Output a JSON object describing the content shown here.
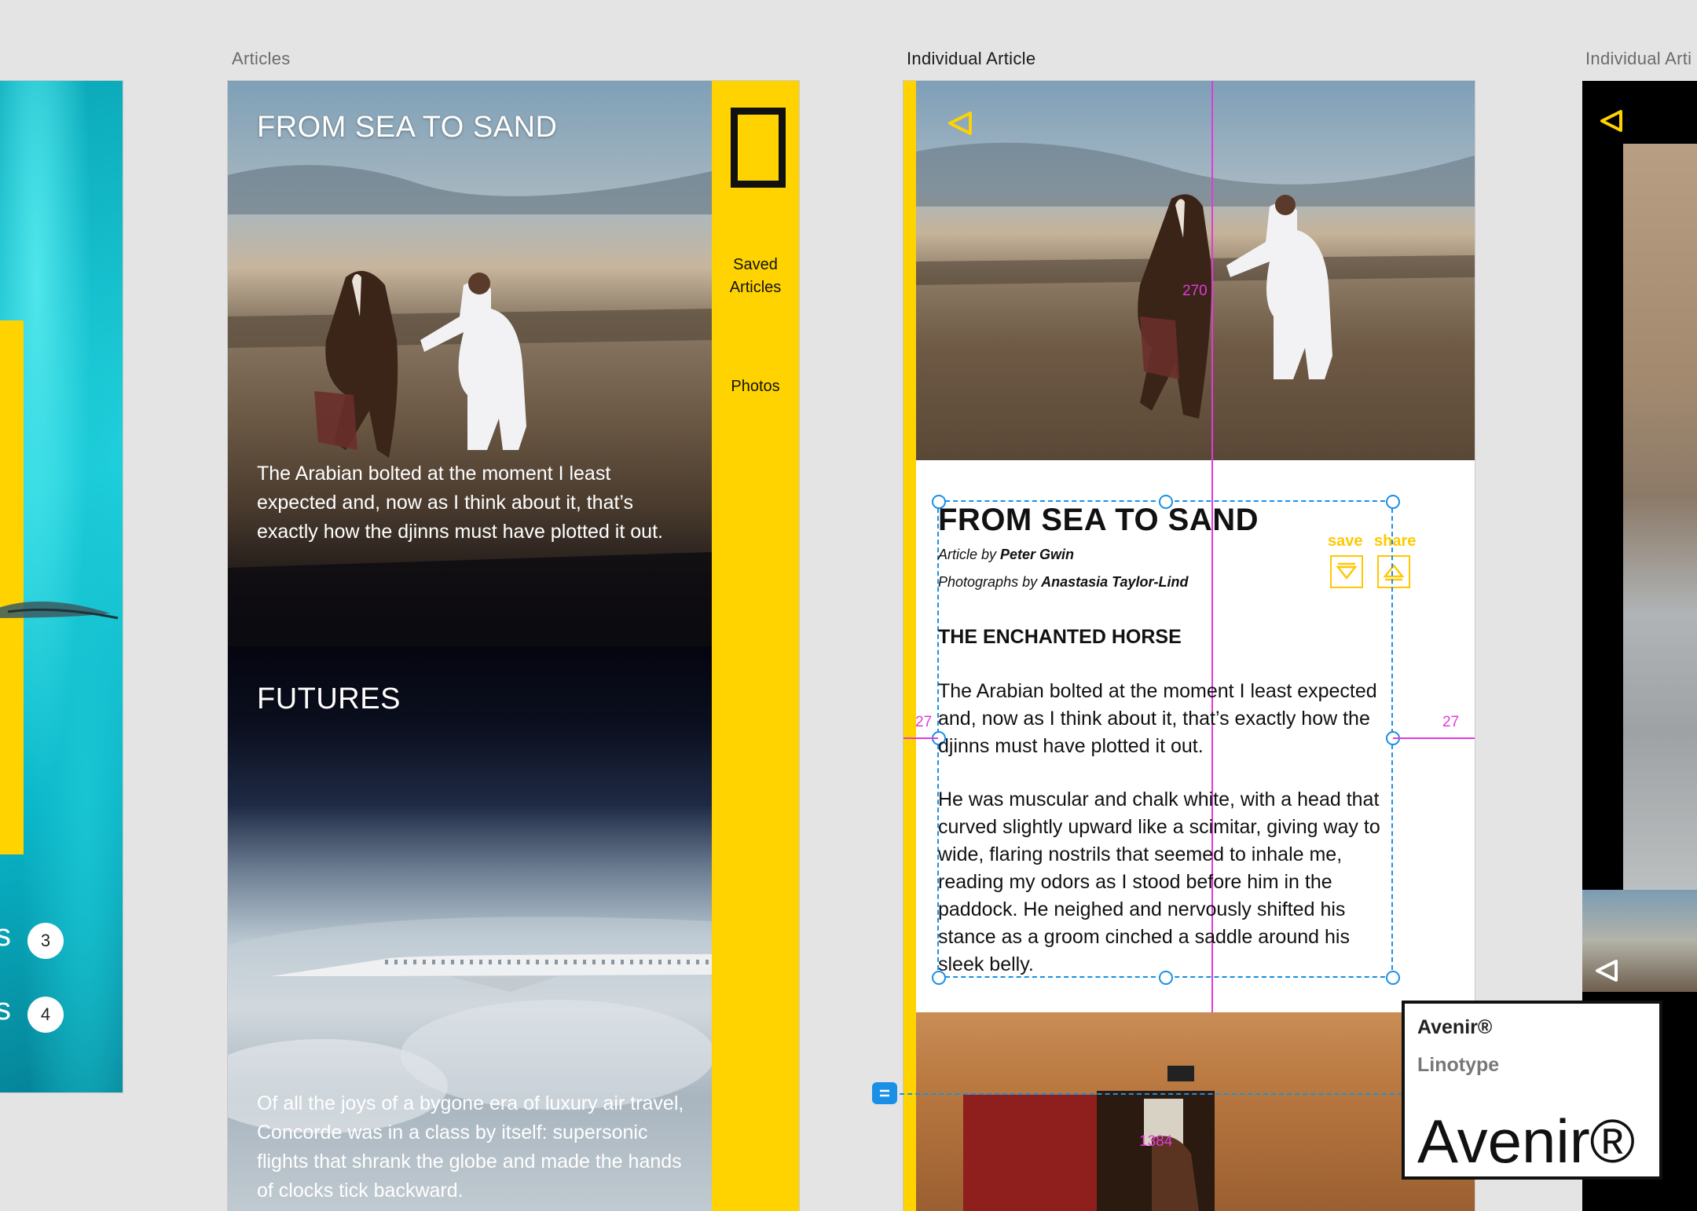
{
  "canvas": {
    "background": "#e4e4e4",
    "accent_yellow": "#ffd300",
    "guide_magenta": "#e23ad8",
    "selection_blue": "#1a8fe6"
  },
  "artboard_labels": {
    "articles": "Articles",
    "individual_article": "Individual Article",
    "individual_article_partial": "Individual Arti"
  },
  "left_artboard": {
    "rows": [
      {
        "letter": "s",
        "count": "3"
      },
      {
        "letter": "s",
        "count": "4"
      }
    ]
  },
  "articles": {
    "items": [
      {
        "title": "FROM SEA TO SAND",
        "excerpt": "The Arabian bolted at the moment I least expected and, now as I think about it, that’s exactly how the djinns must have plotted it out."
      },
      {
        "title": "FUTURES",
        "excerpt": "Of all the joys of a bygone era of luxury air travel, Concorde was in a class by itself: supersonic flights that shrank the globe and made the hands of clocks tick backward."
      }
    ],
    "nav": {
      "logo": "national-geographic-logo",
      "saved_line1": "Saved",
      "saved_line2": "Articles",
      "photos": "Photos"
    }
  },
  "article": {
    "title": "FROM SEA TO SAND",
    "author_prefix": "Article by ",
    "author": "Peter Gwin",
    "photographer_prefix": "Photographs by ",
    "photographer": "Anastasia Taylor-Lind",
    "section": "THE ENCHANTED HORSE",
    "paragraph1": "The Arabian bolted at the moment I least expected and, now as I think about it, that’s exactly how the djinns must have plotted it out.",
    "paragraph2": "He was muscular and chalk white, with a head that curved slightly upward like a scimitar, giving way to wide, flaring nostrils that seemed to inhale me, reading my odors as I stood before him in the paddock. He neighed and nervously shifted his stance as a groom cinched a saddle around his sleek belly.",
    "save_label": "save",
    "share_label": "share",
    "measure_left": "27",
    "measure_right": "27",
    "measure_top": "270",
    "measure_bottom": "1384"
  },
  "font_inspector": {
    "name": "Avenir®",
    "foundry": "Linotype",
    "sample": "Avenir®"
  }
}
